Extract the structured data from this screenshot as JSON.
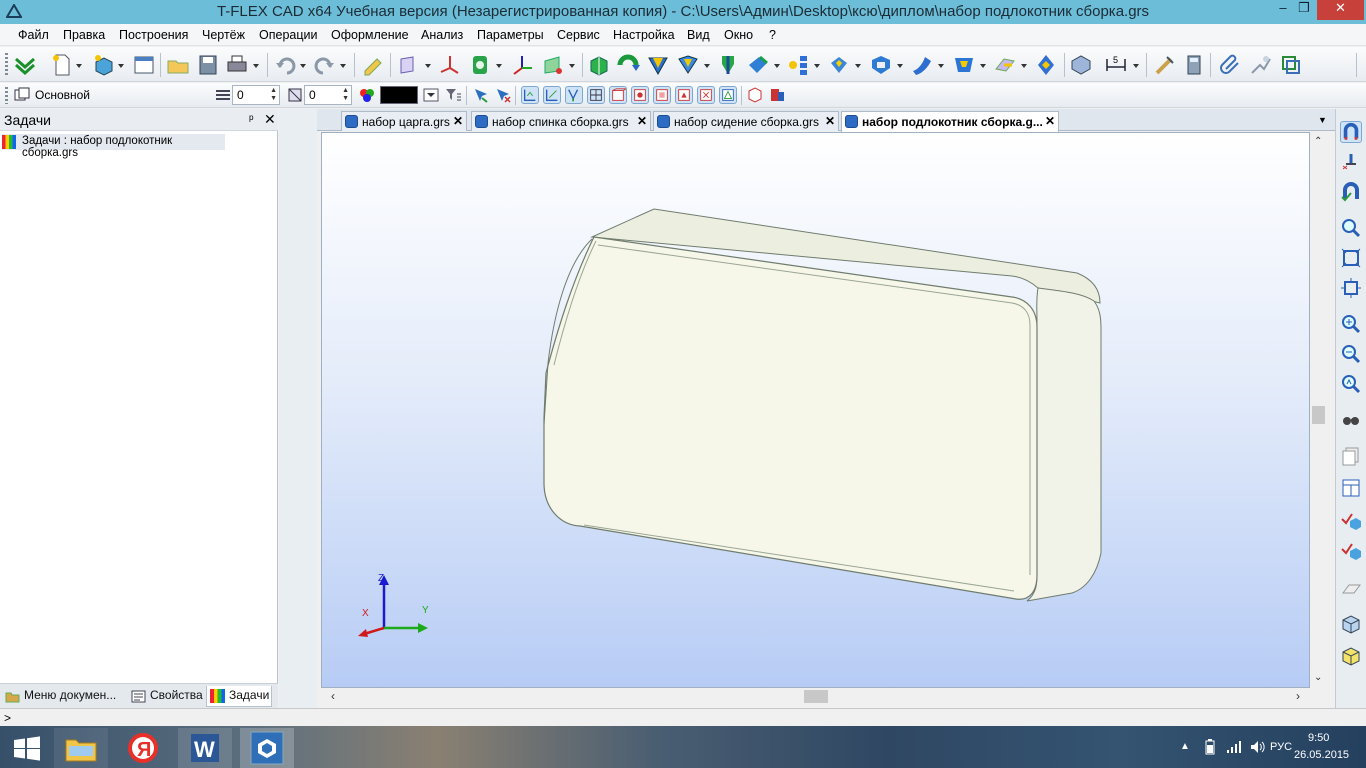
{
  "window": {
    "title": "T-FLEX CAD x64 Учебная версия (Незарегистрированная копия) - C:\\Users\\Админ\\Desktop\\ксю\\диплом\\набор подлокотник сборка.grs",
    "controls": {
      "minimize": "‒",
      "restore": "❐",
      "close": "✕"
    }
  },
  "menu": [
    "Файл",
    "Правка",
    "Построения",
    "Чертёж",
    "Операции",
    "Оформление",
    "Анализ",
    "Параметры",
    "Сервис",
    "Настройка",
    "Вид",
    "Окно",
    "?"
  ],
  "toolbar2": {
    "style_label": "Основной",
    "layer_value": "0",
    "level_value": "0",
    "color_swatch": "#000000"
  },
  "left_panel": {
    "title": "Задачи",
    "pin": "ᵖ",
    "close": "✕",
    "item": "Задачи : набор подлокотник сборка.grs",
    "tabs": [
      {
        "label": "Меню докумен...",
        "icon": "folder-icon"
      },
      {
        "label": "Свойства",
        "icon": "properties-icon"
      },
      {
        "label": "Задачи",
        "icon": "tasks-icon"
      }
    ],
    "active_tab": 2
  },
  "doc_tabs": [
    {
      "label": "набор царга.grs",
      "active": false
    },
    {
      "label": "набор спинка сборка.grs",
      "active": false
    },
    {
      "label": "набор сидение сборка.grs",
      "active": false
    },
    {
      "label": "набор подлокотник сборка.g...",
      "active": true
    }
  ],
  "axes": {
    "x": "X",
    "y": "Y",
    "z": "Z"
  },
  "statusbar": {
    "prompt": ">"
  },
  "taskbar": {
    "apps": [
      "start-button",
      "file-explorer",
      "yandex-browser",
      "word",
      "tflex-cad"
    ],
    "tray": {
      "lang": "РУС",
      "time": "9:50",
      "date": "26.05.2015"
    }
  },
  "colors": {
    "titlebar": "#6cbed8",
    "viewport_top": "#ffffff",
    "viewport_bottom": "#b7ccf5",
    "model_fill": "#f6f7e9",
    "model_edge": "#7d8a7a"
  }
}
